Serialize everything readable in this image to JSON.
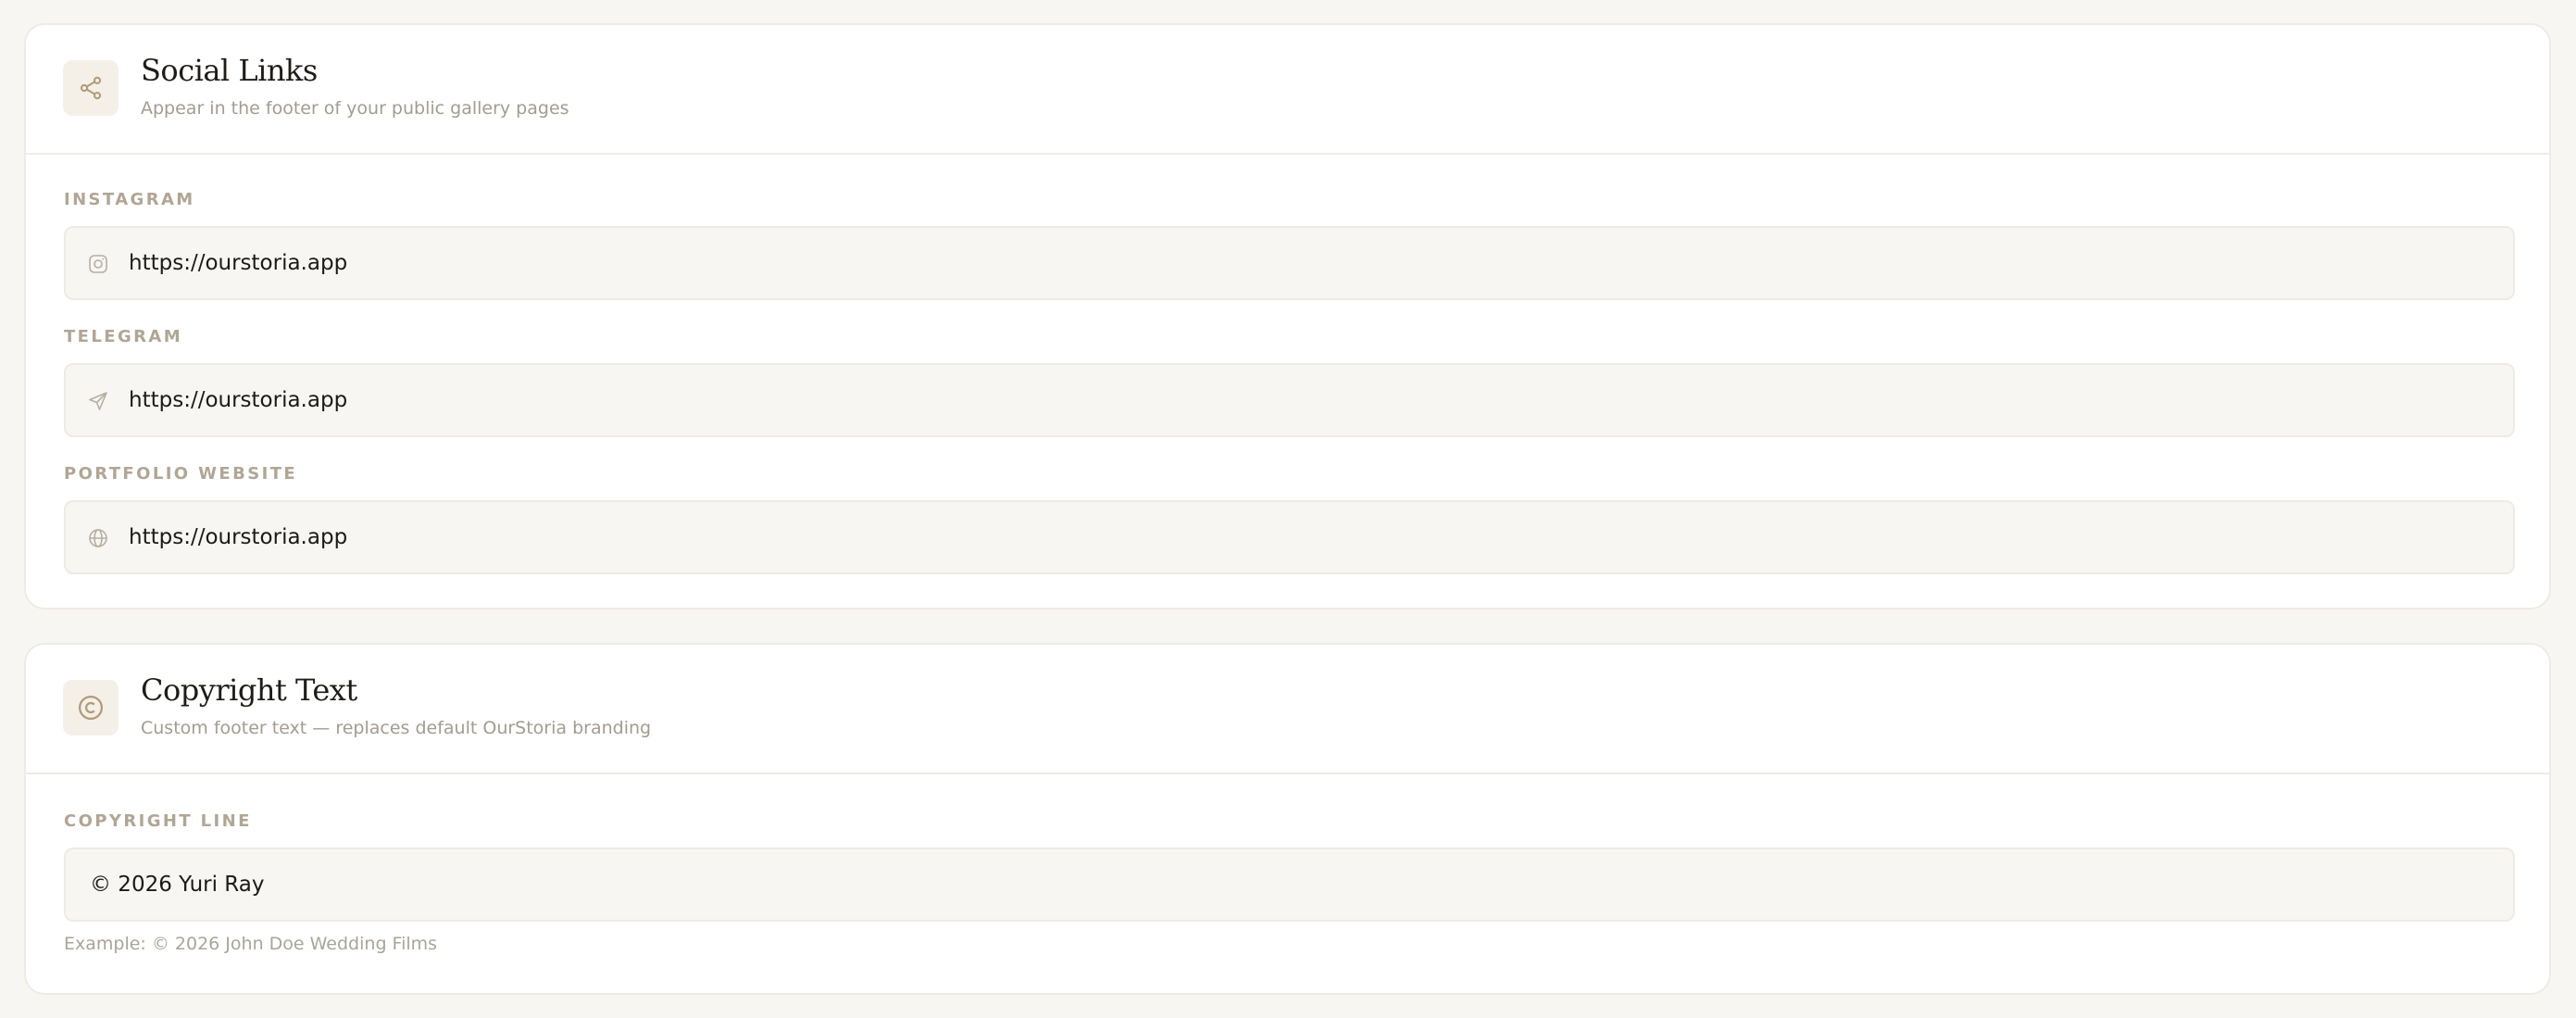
{
  "social": {
    "title": "Social Links",
    "subtitle": "Appear in the footer of your public gallery pages",
    "header_icon": "share-icon",
    "fields": [
      {
        "label": "INSTAGRAM",
        "value": "https://ourstoria.app",
        "icon": "instagram-icon"
      },
      {
        "label": "TELEGRAM",
        "value": "https://ourstoria.app",
        "icon": "telegram-send-icon"
      },
      {
        "label": "PORTFOLIO WEBSITE",
        "value": "https://ourstoria.app",
        "icon": "globe-icon"
      }
    ]
  },
  "copyright": {
    "title": "Copyright Text",
    "subtitle": "Custom footer text — replaces default OurStoria branding",
    "header_icon": "copyright-icon",
    "field": {
      "label": "COPYRIGHT LINE",
      "value": "© 2026 Yuri Ray"
    },
    "hint": "Example: © 2026 John Doe Wedding Films"
  },
  "colors": {
    "page_bg": "#f8f6f2",
    "card_bg": "#ffffff",
    "accent_icon": "#b39a78",
    "label": "#b1a595",
    "muted_text": "#a29c92"
  }
}
